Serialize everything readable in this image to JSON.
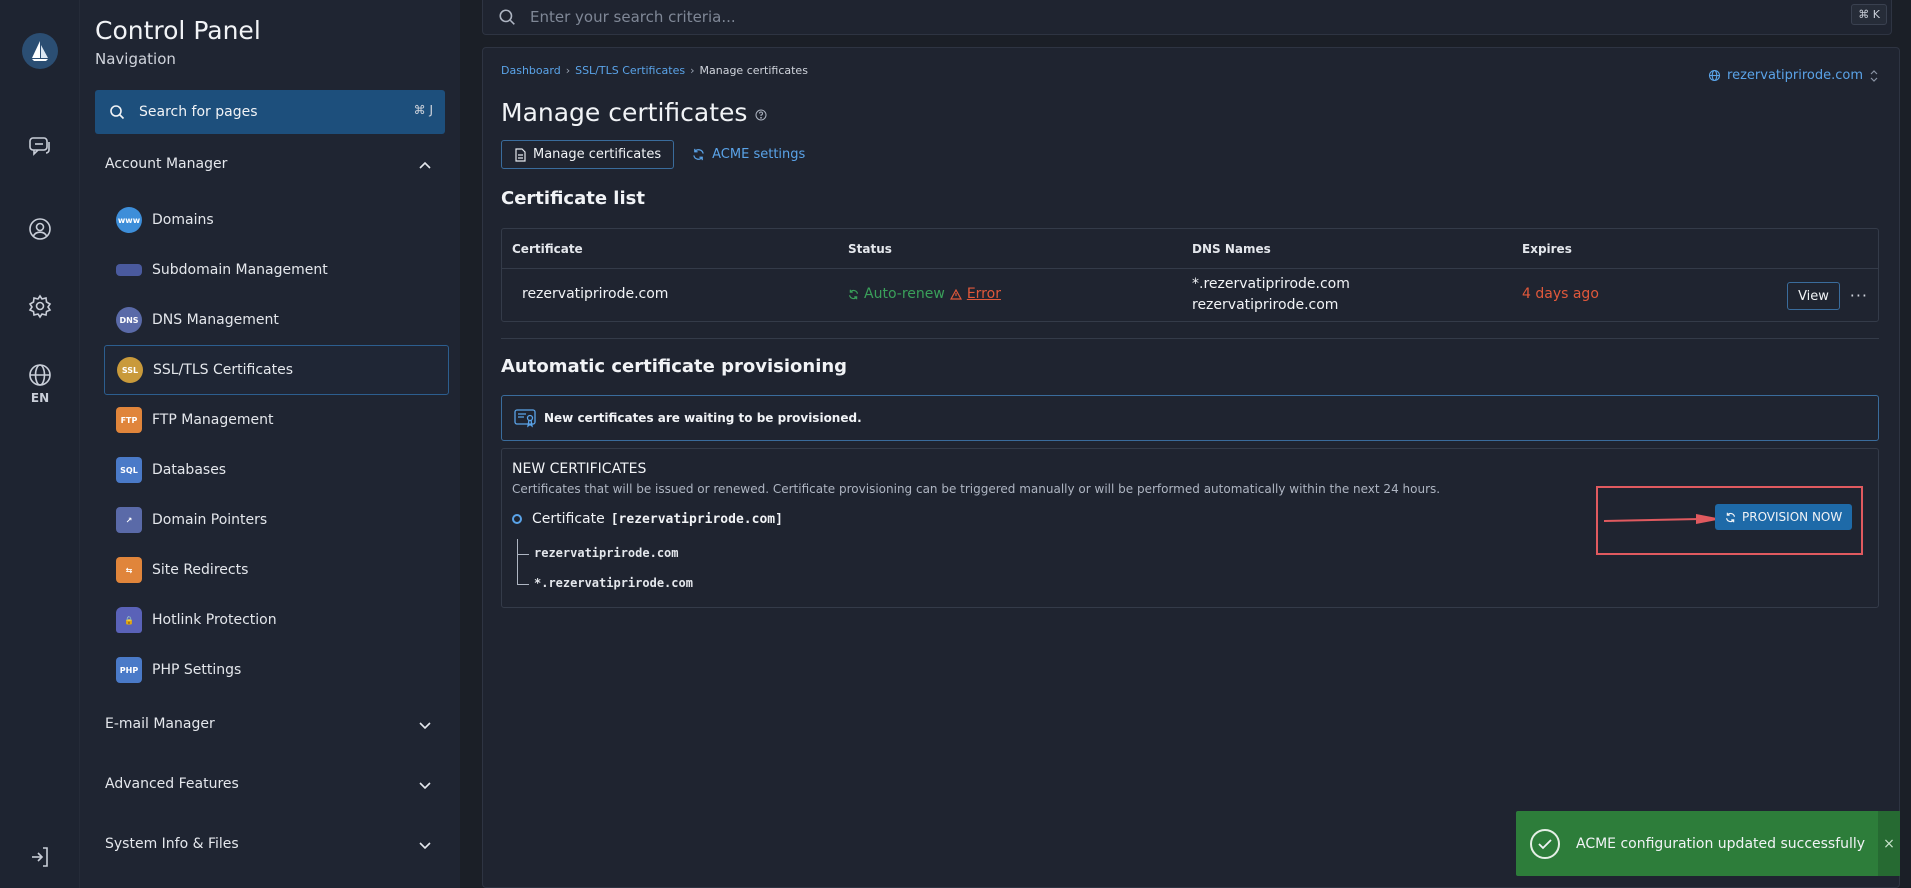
{
  "nav": {
    "title": "Control Panel",
    "subtitle": "Navigation",
    "search_label": "Search for pages",
    "search_shortcut": "⌘ J",
    "account_manager": "Account Manager",
    "items": [
      {
        "label": "Domains",
        "icon": "domains-icon",
        "color": "#3d8ed9"
      },
      {
        "label": "Subdomain Management",
        "icon": "subdomain-icon",
        "color": "#4a5a9e"
      },
      {
        "label": "DNS Management",
        "icon": "dns-icon",
        "color": "#5a6aa8"
      },
      {
        "label": "SSL/TLS Certificates",
        "icon": "ssl-certificate-icon",
        "color": "#c99a3b"
      },
      {
        "label": "FTP Management",
        "icon": "ftp-icon",
        "color": "#e0853b"
      },
      {
        "label": "Databases",
        "icon": "database-icon",
        "color": "#4a7ac8"
      },
      {
        "label": "Domain Pointers",
        "icon": "domain-pointer-icon",
        "color": "#5a6aa8"
      },
      {
        "label": "Site Redirects",
        "icon": "redirect-icon",
        "color": "#e0853b"
      },
      {
        "label": "Hotlink Protection",
        "icon": "lock-icon",
        "color": "#5a62b8"
      },
      {
        "label": "PHP Settings",
        "icon": "php-icon",
        "color": "#4a7ac8"
      }
    ],
    "email_manager": "E-mail Manager",
    "advanced_features": "Advanced Features",
    "system_info": "System Info & Files"
  },
  "rail": {
    "lang": "EN"
  },
  "topsearch": {
    "placeholder": "Enter your search criteria...",
    "shortcut": "⌘ K"
  },
  "breadcrumb": {
    "dashboard": "Dashboard",
    "ssl": "SSL/TLS Certificates",
    "current": "Manage certificates"
  },
  "domain_select": "rezervatiprirode.com",
  "page_title": "Manage certificates",
  "tabs": {
    "manage": "Manage certificates",
    "acme": "ACME settings"
  },
  "cert_list": {
    "heading": "Certificate list",
    "columns": [
      "Certificate",
      "Status",
      "DNS Names",
      "Expires"
    ],
    "row": {
      "certificate": "rezervatiprirode.com",
      "status_renew": "Auto-renew",
      "status_error": "Error",
      "dns": [
        "*.rezervatiprirode.com",
        "rezervatiprirode.com"
      ],
      "expires": "4 days ago",
      "view": "View",
      "more": "···"
    }
  },
  "provisioning": {
    "heading": "Automatic certificate provisioning",
    "info": "New certificates are waiting to be provisioned.",
    "new_title": "NEW CERTIFICATES",
    "new_desc": "Certificates that will be issued or renewed. Certificate provisioning can be triggered manually or will be performed automatically within the next 24 hours.",
    "cert_label": "Certificate",
    "cert_name": "[rezervatiprirode.com]",
    "names": [
      "rezervatiprirode.com",
      "*.rezervatiprirode.com"
    ],
    "button": "PROVISION NOW"
  },
  "toast": {
    "message": "ACME configuration updated successfully",
    "close": "×"
  },
  "colors": {
    "accent": "#5aa3e8",
    "success": "#2d7d3a",
    "error": "#e0583b",
    "highlight": "#e05a5f"
  }
}
